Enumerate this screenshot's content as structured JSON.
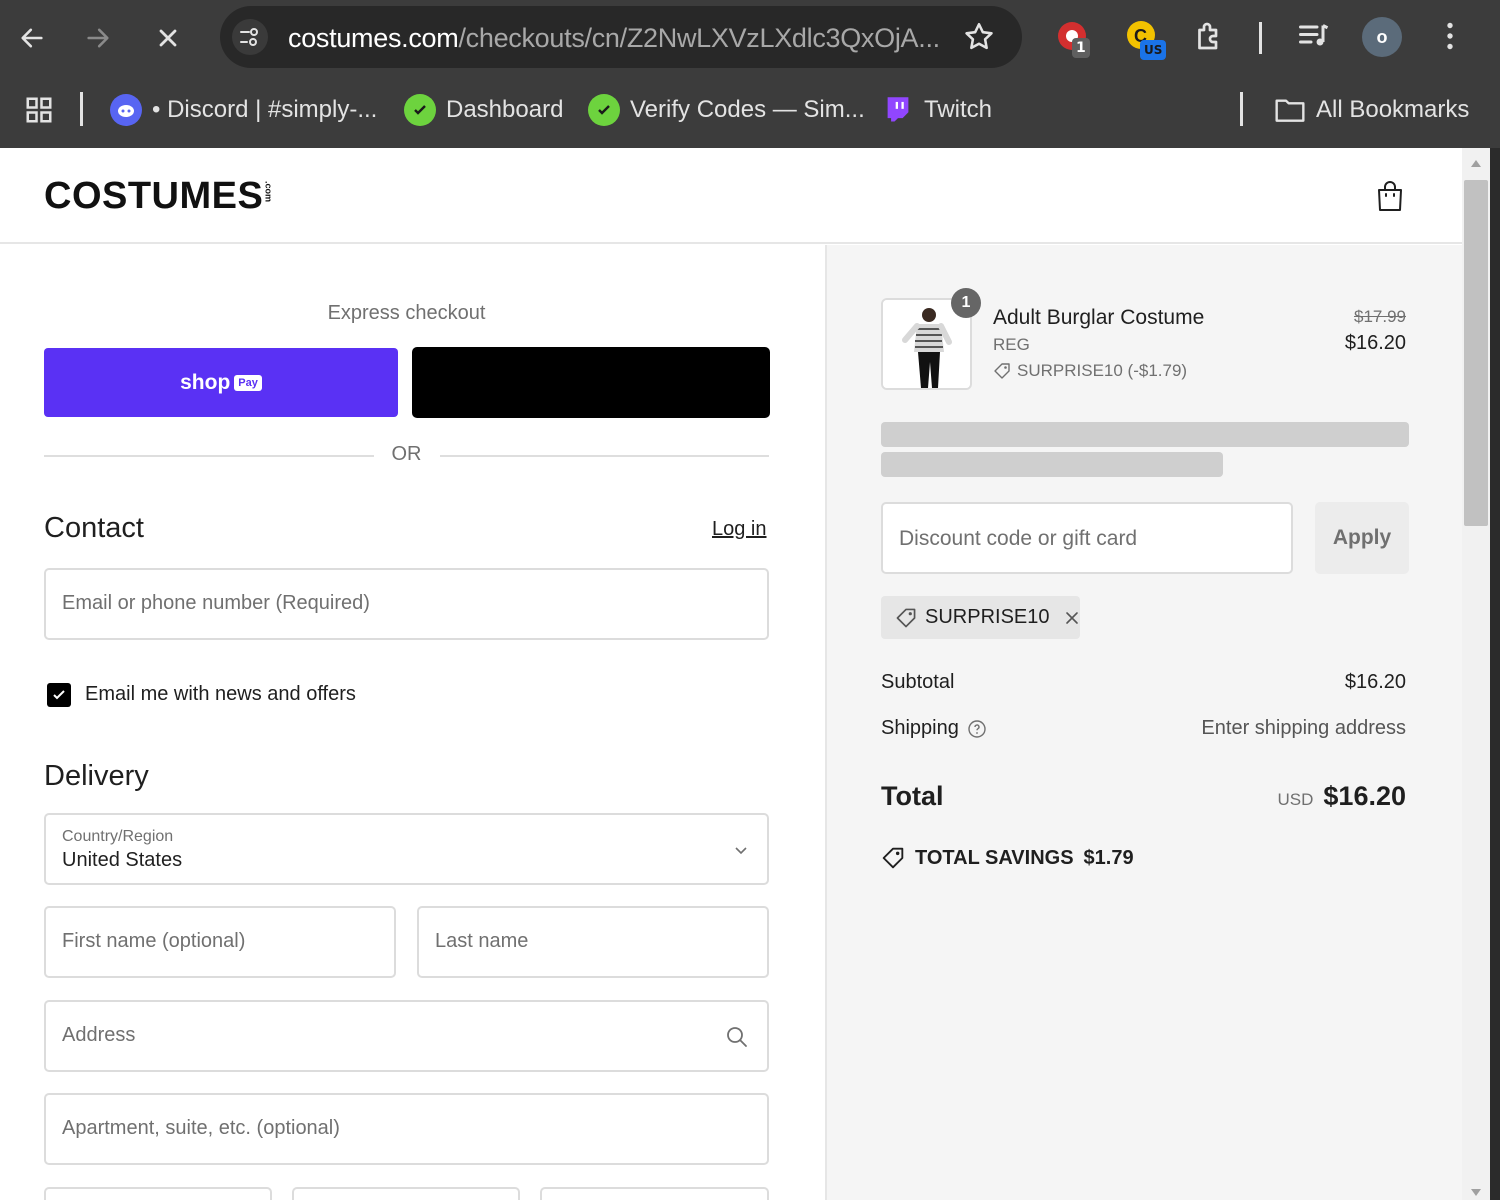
{
  "browser": {
    "url_host": "costumes.com",
    "url_path": "/checkouts/cn/Z2NwLXVzLXdlc3QxOjA...",
    "extensions": [
      {
        "name": "red-extension-icon",
        "badge": "1"
      },
      {
        "name": "yellow-extension-icon",
        "badge": "US"
      }
    ],
    "profile_initial": "o",
    "bookmarks": [
      {
        "label": "• Discord | #simply-..."
      },
      {
        "label": "Dashboard"
      },
      {
        "label": "Verify Codes — Sim..."
      },
      {
        "label": "Twitch"
      }
    ],
    "all_bookmarks": "All Bookmarks"
  },
  "header": {
    "logo": "COSTUMES",
    "logo_suffix": ".com"
  },
  "checkout": {
    "express_label": "Express checkout",
    "shop_pay_label": "shop",
    "shop_pay_badge": "Pay",
    "or": "OR",
    "contact_heading": "Contact",
    "login": "Log in",
    "email_placeholder": "Email or phone number (Required)",
    "news_checkbox_label": "Email me with news and offers",
    "news_checked": true,
    "delivery_heading": "Delivery",
    "country_label": "Country/Region",
    "country_value": "United States",
    "first_name_placeholder": "First name (optional)",
    "last_name_placeholder": "Last name",
    "address_placeholder": "Address",
    "apartment_placeholder": "Apartment, suite, etc. (optional)"
  },
  "summary": {
    "item": {
      "quantity": "1",
      "name": "Adult Burglar Costume",
      "variant": "REG",
      "discount": "SURPRISE10 (-$1.79)",
      "original_price": "$17.99",
      "price": "$16.20"
    },
    "discount_placeholder": "Discount code or gift card",
    "apply": "Apply",
    "applied_code": "SURPRISE10",
    "subtotal_label": "Subtotal",
    "subtotal_value": "$16.20",
    "shipping_label": "Shipping",
    "shipping_value": "Enter shipping address",
    "total_label": "Total",
    "currency": "USD",
    "total_value": "$16.20",
    "savings_label": "TOTAL SAVINGS",
    "savings_value": "$1.79"
  },
  "colors": {
    "shop_pay": "#5a31f4",
    "chrome": "#3c3c3c",
    "summary_bg": "#f5f5f5"
  }
}
